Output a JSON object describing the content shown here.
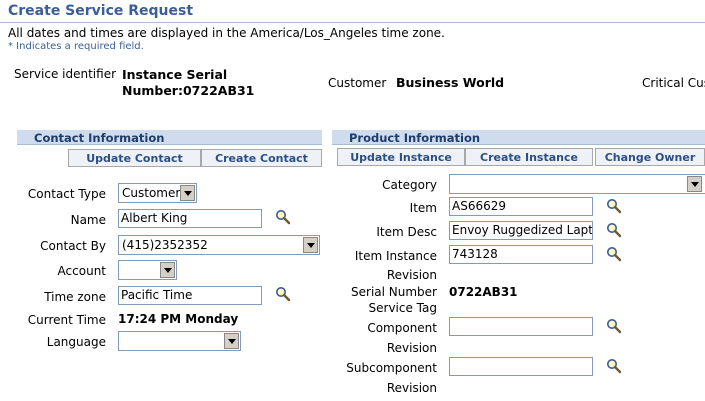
{
  "page": {
    "title": "Create Service Request",
    "timezone_note": "All dates and times are displayed in the America/Los_Angeles time zone.",
    "required_note": "* Indicates a required field."
  },
  "header": {
    "service_identifier_label": "Service identifier",
    "service_identifier_line1": "Instance Serial",
    "service_identifier_line2": "Number:0722AB31",
    "customer_label": "Customer",
    "customer_value": "Business World",
    "critical_label": "Critical Cus"
  },
  "contact": {
    "section_title": "Contact Information",
    "update_button": "Update Contact",
    "create_button": "Create Contact",
    "type_label": "Contact Type",
    "type_value": "Customer",
    "name_label": "Name",
    "name_value": "Albert King",
    "contact_by_label": "Contact By",
    "contact_by_value": "(415)2352352",
    "account_label": "Account",
    "account_value": "",
    "timezone_label": "Time zone",
    "timezone_value": "Pacific Time",
    "current_time_label": "Current Time",
    "current_time_value": "17:24 PM Monday",
    "language_label": "Language",
    "language_value": ""
  },
  "product": {
    "section_title": "Product Information",
    "update_button": "Update Instance",
    "create_button": "Create Instance",
    "change_owner_button": "Change Owner",
    "category_label": "Category",
    "category_value": "",
    "item_label": "Item",
    "item_value": "AS66629",
    "item_desc_label": "Item Desc",
    "item_desc_value": "Envoy Ruggedized Laptop",
    "item_instance_label": "Item Instance",
    "item_instance_value": "743128",
    "revision_label": "Revision",
    "serial_label": "Serial Number",
    "serial_value": "0722AB31",
    "service_tag_label": "Service Tag",
    "component_label": "Component",
    "component_value": "",
    "component_revision_label": "Revision",
    "subcomponent_label": "Subcomponent",
    "subcomponent_value": "",
    "subcomponent_revision_label": "Revision"
  },
  "icons": {
    "search": "search-icon",
    "dropdown": "chevron-down-icon"
  },
  "colors": {
    "title": "#3c5e97",
    "section_header_bg": "#cfdced",
    "button_text": "#2c4f86",
    "input_border": "#7f9db9"
  }
}
